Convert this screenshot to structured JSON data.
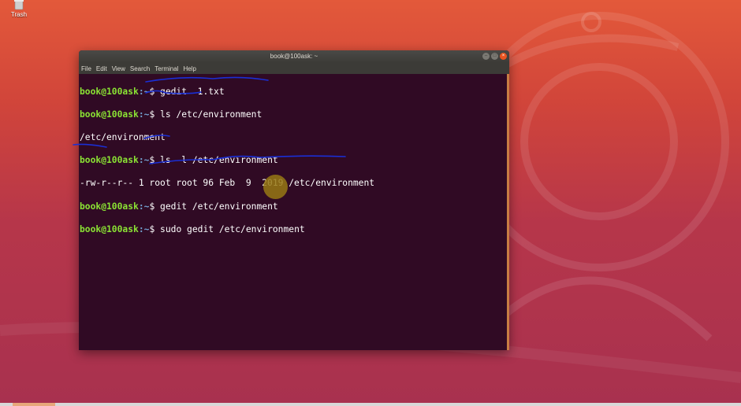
{
  "desktop": {
    "trash_label": "Trash"
  },
  "window": {
    "title": "book@100ask: ~",
    "controls": [
      "–",
      "□",
      "×"
    ]
  },
  "menu": [
    "File",
    "Edit",
    "View",
    "Search",
    "Terminal",
    "Help"
  ],
  "terminal": {
    "prompt_user": "book@100ask",
    "prompt_path": ":~",
    "lines": [
      {
        "type": "prompt",
        "cmd": "$ gedit  1.txt"
      },
      {
        "type": "prompt",
        "cmd": "$ ls /etc/environment"
      },
      {
        "type": "output",
        "text": "/etc/environment"
      },
      {
        "type": "prompt",
        "cmd": "$ ls -l /etc/environment"
      },
      {
        "type": "output",
        "text": "-rw-r--r-- 1 root root 96 Feb  9  2019 /etc/environment"
      },
      {
        "type": "prompt",
        "cmd": "$ gedit /etc/environment"
      },
      {
        "type": "prompt",
        "cmd": "$ sudo gedit /etc/environment"
      }
    ]
  },
  "colors": {
    "terminal_bg": "#300a24",
    "prompt_user": "#8ae234",
    "prompt_path": "#729fcf",
    "annotation": "#1a2fd6"
  }
}
